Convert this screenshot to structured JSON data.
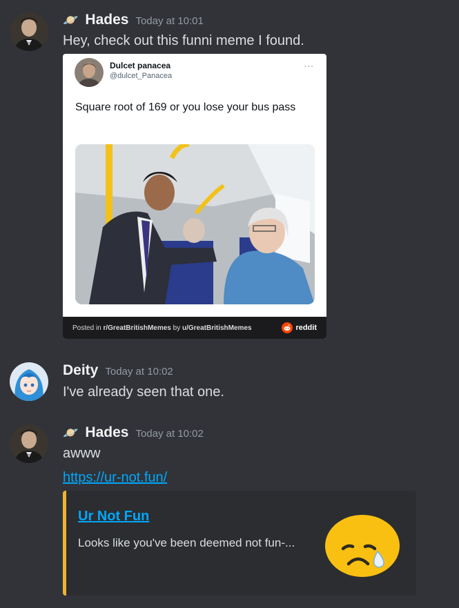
{
  "messages": [
    {
      "username": "Hades",
      "role_icon": "🪐",
      "timestamp": "Today at 10:01",
      "text": "Hey, check out this funni meme I found."
    },
    {
      "username": "Deity",
      "timestamp": "Today at 10:02",
      "text": "I've already seen that one."
    },
    {
      "username": "Hades",
      "role_icon": "🪐",
      "timestamp": "Today at 10:02",
      "text": "awww",
      "link": "https://ur-not.fun/"
    }
  ],
  "tweet": {
    "author_name": "Dulcet panacea",
    "author_handle": "@dulcet_Panacea",
    "more": "...",
    "text": "Square root of 169 or you lose your bus pass",
    "footer_prefix": "Posted in ",
    "subreddit": "r/GreatBritishMemes",
    "footer_mid": " by ",
    "user": "u/GreatBritishMemes",
    "brand": "reddit"
  },
  "embed": {
    "title": "Ur Not Fun",
    "description": "Looks like you've been deemed not fun-...",
    "thumbnail_icon": "sad-emoji-icon",
    "accent_color": "#f0b232"
  },
  "colors": {
    "background": "#313338",
    "link": "#00a8fc",
    "username": "#f2f3f5",
    "timestamp": "#949ba4"
  }
}
